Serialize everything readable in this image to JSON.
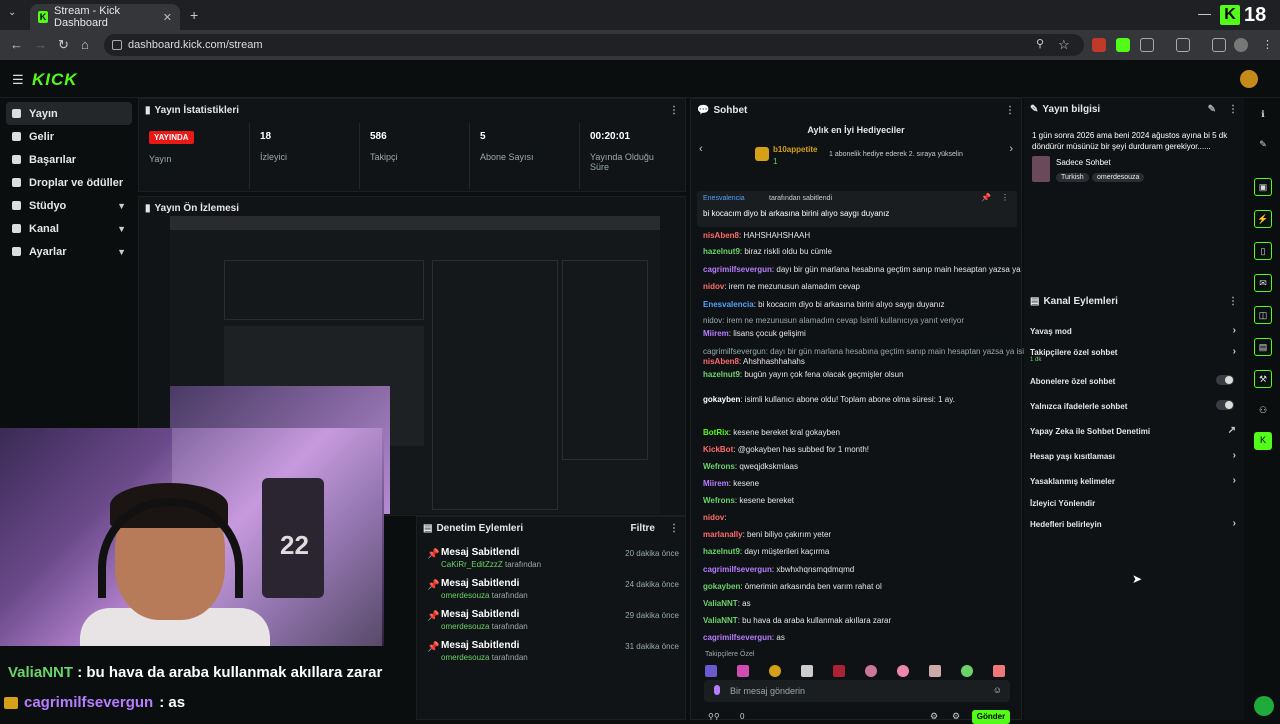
{
  "browser": {
    "tab_title": "Stream - Kick Dashboard",
    "url": "dashboard.kick.com/stream",
    "badge_number": "18"
  },
  "sidebar": {
    "items": [
      {
        "label": "Yayın",
        "icon": "broadcast-icon"
      },
      {
        "label": "Gelir",
        "icon": "wallet-icon"
      },
      {
        "label": "Başarılar",
        "icon": "trophy-icon"
      },
      {
        "label": "Droplar ve ödüller",
        "icon": "gift-icon"
      },
      {
        "label": "Stüdyo",
        "icon": "studio-icon"
      },
      {
        "label": "Kanal",
        "icon": "channel-icon"
      },
      {
        "label": "Ayarlar",
        "icon": "gear-icon"
      }
    ]
  },
  "stats_panel": {
    "title": "Yayın İstatistikleri",
    "live_badge": "YAYINDA",
    "stats": [
      {
        "value": "",
        "label": "Yayın"
      },
      {
        "value": "18",
        "label": "İzleyici"
      },
      {
        "value": "586",
        "label": "Takipçi"
      },
      {
        "value": "5",
        "label": "Abone Sayısı"
      },
      {
        "value": "00:20:01",
        "label": "Yayında Olduğu Süre"
      }
    ]
  },
  "preview_panel": {
    "title": "Yayın Ön İzlemesi"
  },
  "webcam": {
    "jersey_number": "22"
  },
  "captions": [
    {
      "user": "ValiaNNT",
      "text": ": bu hava da araba kullanmak akıllara zarar"
    },
    {
      "user": "cagrimilfsevergun",
      "text": ": as"
    }
  ],
  "mod_log": {
    "title": "Denetim Eylemleri",
    "filter_label": "Filtre",
    "items": [
      {
        "title": "Mesaj Sabitlendi",
        "user": "CaKiRr_EditZzzZ",
        "suffix": "tarafından",
        "time": "20 dakika önce"
      },
      {
        "title": "Mesaj Sabitlendi",
        "user": "omerdesouza",
        "suffix": "tarafından",
        "time": "24 dakika önce"
      },
      {
        "title": "Mesaj Sabitlendi",
        "user": "omerdesouza",
        "suffix": "tarafından",
        "time": "29 dakika önce"
      },
      {
        "title": "Mesaj Sabitlendi",
        "user": "omerdesouza",
        "suffix": "tarafından",
        "time": "31 dakika önce"
      }
    ]
  },
  "chat": {
    "title": "Sohbet",
    "top_gifters_title": "Aylık en İyi Hediyeciler",
    "top_gifter_name": "b10appetite",
    "top_gifter_count": "1",
    "top_gifter_note": "1 abonelik hediye ederek 2. sıraya yükselin",
    "pinned_by": "Enesvalencia",
    "pinned_suffix": "tarafından sabitlendi",
    "pinned_text": "bi kocacım diyo bi arkasına birini alıyo saygı duyanız",
    "messages": [
      {
        "user": "nisAben8",
        "text": "HAHSHAHSHAAH",
        "color": "#ff6b6b"
      },
      {
        "user": "hazelnut9",
        "text": "biraz riskli oldu bu cümle",
        "color": "#6bd36b"
      },
      {
        "user": "cagrimilfsevergun",
        "text": "dayı bir gün marlana hesabına geçtim sanıp main hesaptan yazsa ya",
        "color": "#b77dff"
      },
      {
        "user": "nidov",
        "text": "irem ne mezunusun alamadım cevap",
        "color": "#ff6b6b"
      },
      {
        "user": "Enesvalencia",
        "text": "bi kocacım diyo bi arkasına birini alıyo saygı duyanız",
        "color": "#4fa3ff"
      },
      {
        "user": "",
        "text": "nidov: irem ne mezunusun alamadım cevap İsimli kullanıcıya yanıt veriyor",
        "color": "#9aa"
      },
      {
        "user": "Miirem",
        "text": "lisans çocuk gelişimi",
        "color": "#b77dff"
      },
      {
        "user": "",
        "text": "cagrimilfsevergun: dayı bir gün marlana hesabına geçtim sanıp main hesaptan yazsa ya isimli k...",
        "color": "#9aa"
      },
      {
        "user": "nisAben8",
        "text": "Ahshhashhahahs",
        "color": "#ff6b6b"
      },
      {
        "user": "hazelnut9",
        "text": "bugün yayın çok fena olacak geçmişler olsun",
        "color": "#6bd36b"
      },
      {
        "user": "gokayben",
        "text": "isimli kullanıcı abone oldu! Toplam abone olma süresi: 1 ay.",
        "color": "#fff"
      },
      {
        "user": "BotRix",
        "text": "kesene bereket kral gokayben",
        "color": "#53fc18"
      },
      {
        "user": "KickBot",
        "text": "@gokayben has subbed for 1 month!",
        "color": "#ff6b6b"
      },
      {
        "user": "Wefrons",
        "text": "qweqjdkskmlaas",
        "color": "#6bd36b"
      },
      {
        "user": "Miirem",
        "text": "kesene",
        "color": "#b77dff"
      },
      {
        "user": "Wefrons",
        "text": "kesene bereket",
        "color": "#6bd36b"
      },
      {
        "user": "nidov",
        "text": "",
        "color": "#ff6b6b"
      },
      {
        "user": "marlanally",
        "text": "beni biliyo çakırım yeter",
        "color": "#ff6b6b"
      },
      {
        "user": "hazelnut9",
        "text": "dayı müşterileri kaçırma",
        "color": "#6bd36b"
      },
      {
        "user": "cagrimilfsevergun",
        "text": "xbwhxhqnsmqdmqmd",
        "color": "#b77dff"
      },
      {
        "user": "gokayben",
        "text": "ömerimin arkasında ben varım rahat ol",
        "color": "#6bd36b"
      },
      {
        "user": "ValiaNNT",
        "text": "as",
        "color": "#6bd36b"
      },
      {
        "user": "ValiaNNT",
        "text": "bu hava da araba kullanmak akıllara zarar",
        "color": "#6bd36b"
      },
      {
        "user": "cagrimilfsevergun",
        "text": "as",
        "color": "#b77dff"
      }
    ],
    "followers_only_label": "Takipçilere Özel",
    "input_placeholder": "Bir mesaj gönderin",
    "send_label": "Gönder",
    "viewer_count": "0"
  },
  "stream_info": {
    "title": "Yayın bilgisi",
    "stream_title": "1 gün sonra 2026 ama beni 2024 ağustos ayına bi 5 dk döndürür müsünüz bir şeyi durduram gerekiyor......",
    "category": "Sadece Sohbet",
    "tags": [
      "Turkish",
      "omerdesouza"
    ]
  },
  "channel_actions": {
    "title": "Kanal Eylemleri",
    "items": [
      {
        "label": "Yavaş mod",
        "kind": "arrow"
      },
      {
        "label": "Takipçilere özel sohbet",
        "sub": "1 dk",
        "kind": "arrow"
      },
      {
        "label": "Abonelere özel sohbet",
        "kind": "toggle"
      },
      {
        "label": "Yalnızca ifadelerle sohbet",
        "kind": "toggle"
      },
      {
        "label": "Yapay Zeka ile Sohbet Denetimi",
        "kind": "external"
      },
      {
        "label": "Hesap yaşı kısıtlaması",
        "kind": "arrow"
      },
      {
        "label": "Yasaklanmış kelimeler",
        "kind": "arrow"
      },
      {
        "label": "İzleyici Yönlendir",
        "kind": "none"
      },
      {
        "label": "Hedefleri belirleyin",
        "kind": "arrow"
      }
    ]
  }
}
